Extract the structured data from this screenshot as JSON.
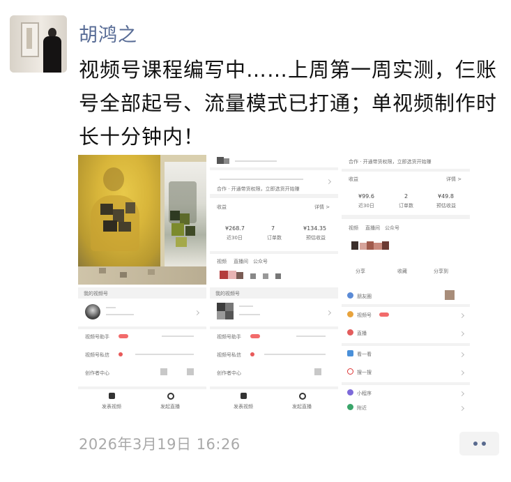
{
  "post": {
    "author": "胡鸿之",
    "text": "视频号课程编写中……上周第一周实测，仨账号全部起号、流量模式已打通；单视频制作时长十分钟内！",
    "timestamp": "2026年3月19日 16:26"
  },
  "colors": {
    "author_name": "#576b95",
    "timestamp": "#a9a9a9",
    "more_dots": "#596a8e"
  },
  "icons": {
    "more": "more-dots-icon"
  },
  "grid": {
    "s2": {
      "banner": "合作 · 开通带货权限，立即选货开始赚",
      "section": "收益",
      "link": "详情 >",
      "stats": [
        {
          "value": "¥268.7",
          "label": "近30日"
        },
        {
          "value": "7",
          "label": "订单数"
        },
        {
          "value": "¥134.35",
          "label": "预估收益"
        }
      ],
      "tabs": [
        "视频",
        "直播间",
        "公众号"
      ]
    },
    "s3": {
      "banner": "合作 · 开通带货权限，立即选货开始赚",
      "section": "收益",
      "link": "详情 >",
      "stats": [
        {
          "value": "¥99.6",
          "label": "近30日"
        },
        {
          "value": "2",
          "label": "订单数"
        },
        {
          "value": "¥49.8",
          "label": "预估收益"
        }
      ],
      "tabs": [
        "视频",
        "直播间",
        "公众号"
      ],
      "actions": [
        "分享",
        "收藏",
        "分享到"
      ]
    },
    "s4": {
      "header": "我的视频号",
      "rows": [
        "视频号助手",
        "视频号私信",
        "创作者中心"
      ],
      "bottom": [
        "发表视频",
        "发起直播"
      ]
    },
    "s5": {
      "header": "我的视频号",
      "rows": [
        "视频号助手",
        "视频号私信",
        "创作者中心"
      ],
      "bottom": [
        "发表视频",
        "发起直播"
      ]
    },
    "s6": {
      "rows": [
        "朋友圈",
        "视频号",
        "直播",
        "看一看",
        "搜一搜",
        "小程序",
        "附近"
      ]
    }
  }
}
